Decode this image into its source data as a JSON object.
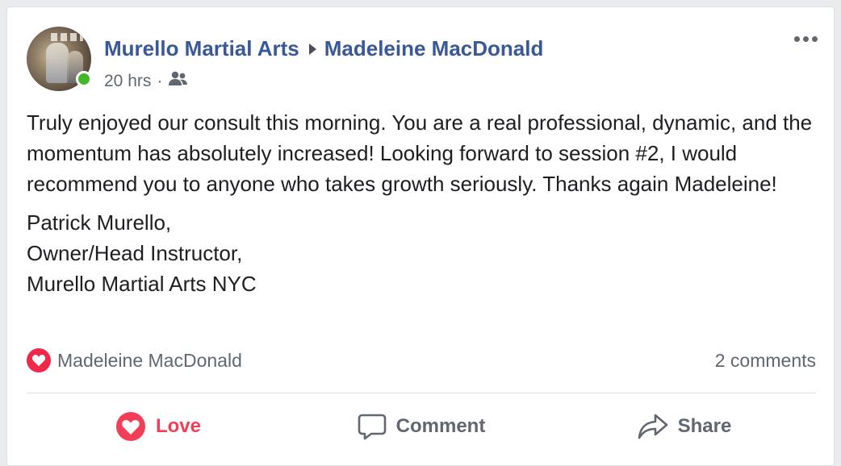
{
  "post": {
    "page_name": "Murello Martial Arts",
    "target_name": "Madeleine MacDonald",
    "time": "20 hrs",
    "separator": "·",
    "audience_icon": "group-icon",
    "paragraphs": [
      "Truly enjoyed our consult this morning. You are a real professional, dynamic, and the momentum has absolutely increased! Looking forward to session #2, I would recommend you to anyone who takes growth seriously. Thanks again Madeleine!"
    ],
    "signature": [
      "Patrick Murello,",
      "Owner/Head Instructor,",
      "Murello Martial Arts NYC"
    ]
  },
  "reactions": {
    "icon": "heart-icon",
    "names": "Madeleine MacDonald",
    "comments": "2 comments"
  },
  "actions": {
    "love": "Love",
    "comment": "Comment",
    "share": "Share"
  },
  "colors": {
    "link": "#385898",
    "love": "#f33e58",
    "online": "#42b72a",
    "muted": "#606770"
  }
}
